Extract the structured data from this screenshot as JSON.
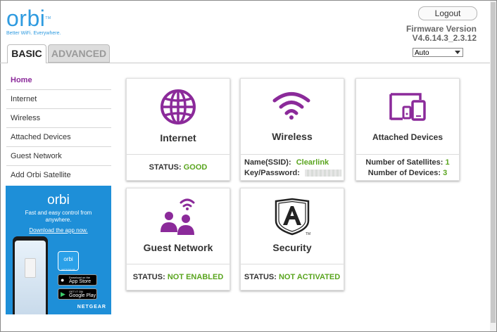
{
  "logo": {
    "word": "orbi",
    "tm": "TM",
    "tagline": "Better WiFi. Everywhere."
  },
  "header": {
    "logout_label": "Logout",
    "firmware_label": "Firmware Version",
    "firmware_version": "V4.6.14.3_2.3.12",
    "language_selected": "Auto"
  },
  "tabs": {
    "basic": "BASIC",
    "advanced": "ADVANCED",
    "active": "BASIC"
  },
  "sidebar": {
    "items": [
      {
        "label": "Home",
        "active": true
      },
      {
        "label": "Internet"
      },
      {
        "label": "Wireless"
      },
      {
        "label": "Attached Devices"
      },
      {
        "label": "Guest Network"
      },
      {
        "label": "Add Orbi Satellite"
      }
    ]
  },
  "promo": {
    "logo": "orbi",
    "text": "Fast and easy control from anywhere.",
    "link": "Download the app now.",
    "app_icon_label": "orbi",
    "app_icon_sub": "NETGEAR",
    "app_store_small": "Download on the",
    "app_store_big": "App Store",
    "play_small": "GET IT ON",
    "play_big": "Google Play",
    "brand": "NETGEAR",
    "bg_color": "#1e8fd8"
  },
  "cards": {
    "internet": {
      "title": "Internet",
      "icon": "globe-icon",
      "status_label": "STATUS:",
      "status_value": "GOOD"
    },
    "wireless": {
      "title": "Wireless",
      "icon": "wifi-icon",
      "ssid_label": "Name(SSID):",
      "ssid_value": "Clearlink",
      "key_label": "Key/Password:"
    },
    "devices": {
      "title": "Attached Devices",
      "icon": "devices-icon",
      "satellites_label": "Number of Satellites:",
      "satellites_value": "1",
      "devices_label": "Number of Devices:",
      "devices_value": "3"
    },
    "guest": {
      "title": "Guest Network",
      "icon": "guest-network-icon",
      "status_label": "STATUS:",
      "status_value": "NOT ENABLED"
    },
    "security": {
      "title": "Security",
      "icon": "armor-shield-icon",
      "tm": "TM",
      "status_label": "STATUS:",
      "status_value": "NOT ACTIVATED"
    }
  },
  "colors": {
    "accent_purple": "#8b2a9a",
    "status_green": "#5aa51f",
    "brand_blue": "#2f9be0"
  }
}
